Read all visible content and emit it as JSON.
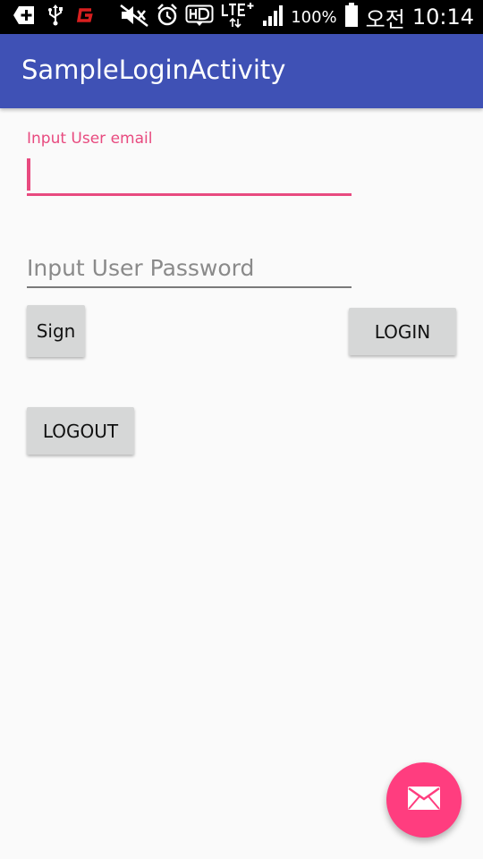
{
  "status_bar": {
    "battery_percent": "100%",
    "am_pm": "오전",
    "time": "10:14",
    "background": "#000000",
    "icons": [
      "add-box-icon",
      "usb-icon",
      "app-g-icon",
      "mute-icon",
      "alarm-icon",
      "hd-icon",
      "lte-plus-icon",
      "signal-icon",
      "battery-icon"
    ]
  },
  "app_bar": {
    "title": "SampleLoginActivity",
    "background": "#3f51b5"
  },
  "form": {
    "email_label": "Input User email",
    "email_value": "",
    "password_placeholder": "Input User Password",
    "password_value": "",
    "accent_color": "#e84a7f"
  },
  "buttons": {
    "sign_label": "Sign",
    "login_label": "LOGIN",
    "logout_label": "LOGOUT",
    "background": "#d6d7d7"
  },
  "fab": {
    "icon": "mail-icon",
    "background": "#ff3d7f"
  }
}
